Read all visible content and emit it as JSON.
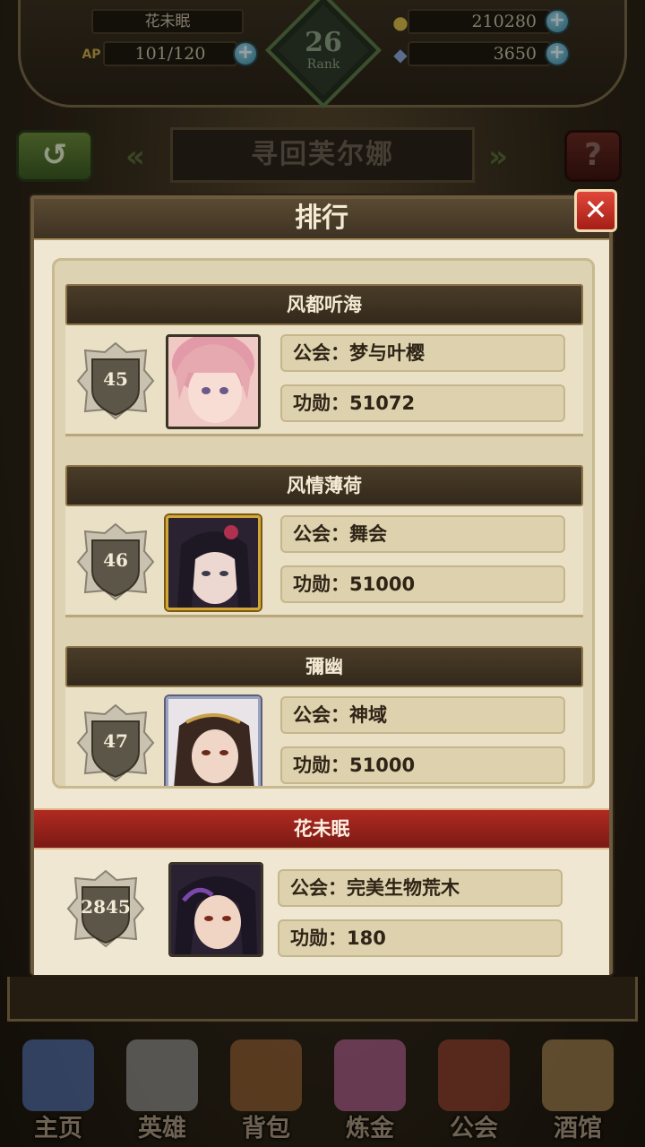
{
  "hud": {
    "player_name": "花未眠",
    "ap_label": "AP",
    "ap_value": "101/120",
    "rank_number": "26",
    "rank_label": "Rank",
    "gold_value": "210280",
    "gem_value": "3650",
    "plus_symbol": "+"
  },
  "stage": {
    "title": "寻回芙尔娜",
    "back_icon": "back-arrow-icon",
    "help_label": "?"
  },
  "popup": {
    "title": "排行",
    "close_label": "✕"
  },
  "rankings": [
    {
      "name": "风都听海",
      "rank": "45",
      "guild": "公会：梦与叶樱",
      "merit": "功勋：51072",
      "avatar_color": "#e7a9b0",
      "frame": "plain"
    },
    {
      "name": "风情薄荷",
      "rank": "46",
      "guild": "公会：舞会",
      "merit": "功勋：51000",
      "avatar_color": "#3b3346",
      "frame": "gold"
    },
    {
      "name": "彌幽",
      "rank": "47",
      "guild": "公会：神域",
      "merit": "功勋：51000",
      "avatar_color": "#4a3426",
      "frame": "silver"
    }
  ],
  "me": {
    "name": "花未眠",
    "rank": "2845",
    "guild": "公会：完美生物荒木",
    "merit": "功勋：180",
    "avatar_color": "#2f2540"
  },
  "nav": [
    {
      "label": "主页",
      "icon": "castle-icon",
      "color": "#4a6aa8"
    },
    {
      "label": "英雄",
      "icon": "knight-helmet-icon",
      "color": "#8a8a8a"
    },
    {
      "label": "背包",
      "icon": "backpack-icon",
      "color": "#8a5a30"
    },
    {
      "label": "炼金",
      "icon": "potion-icon",
      "color": "#a85a8a"
    },
    {
      "label": "公会",
      "icon": "guild-shield-icon",
      "color": "#8a3a2a"
    },
    {
      "label": "酒馆",
      "icon": "beer-mug-icon",
      "color": "#9a7a4a"
    }
  ]
}
